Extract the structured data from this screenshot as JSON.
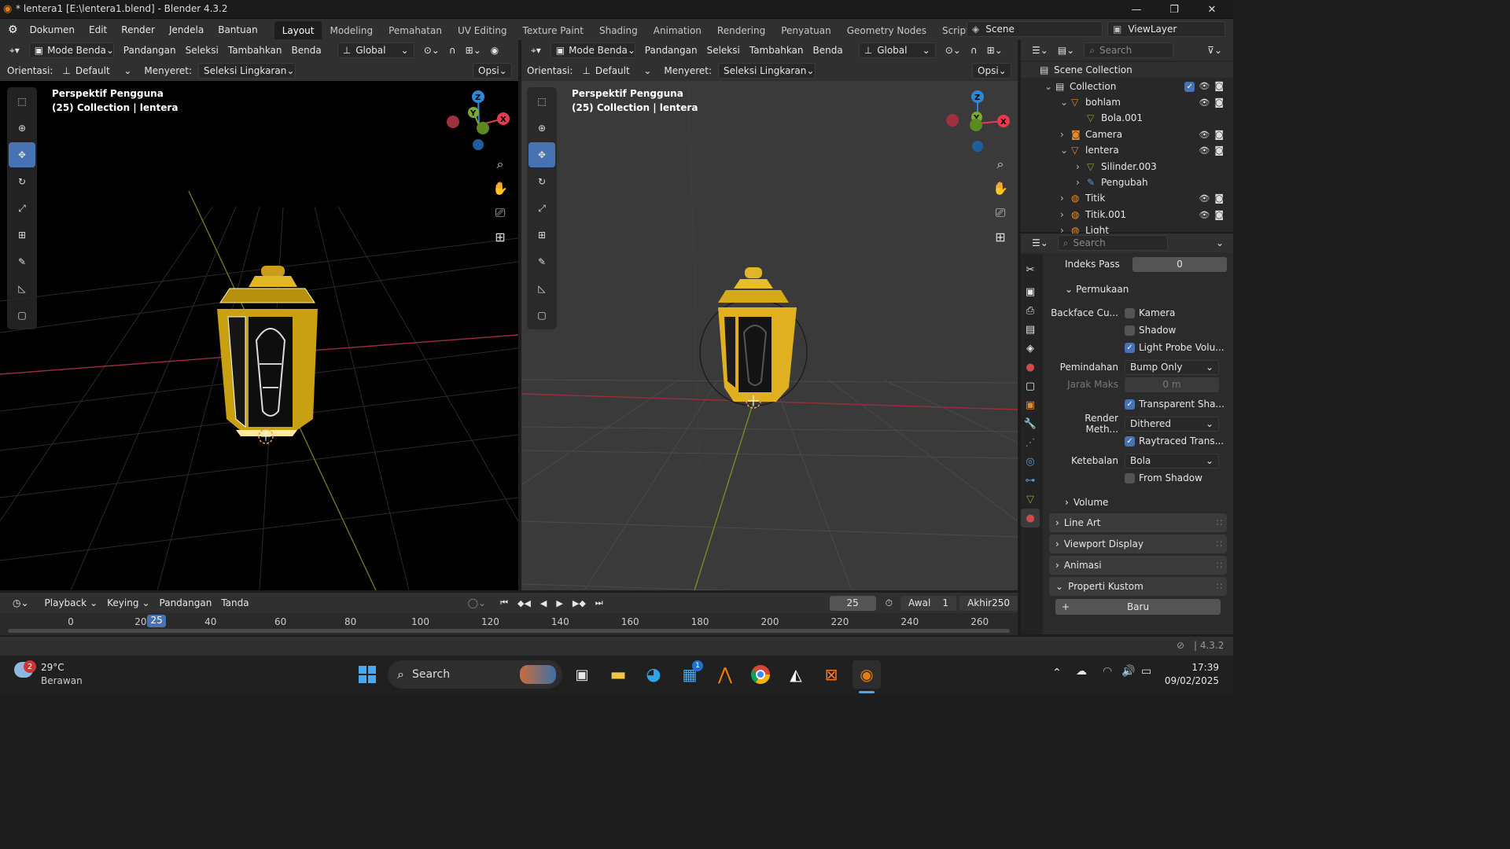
{
  "window": {
    "title": "* lentera1 [E:\\lentera1.blend] - Blender 4.3.2",
    "minimize": "—",
    "maximize": "❐",
    "close": "✕"
  },
  "menu": {
    "logo": "⚙",
    "items": [
      "Dokumen",
      "Edit",
      "Render",
      "Jendela",
      "Bantuan"
    ]
  },
  "workspaces": [
    "Layout",
    "Modeling",
    "Pemahatan",
    "UV Editing",
    "Texture Paint",
    "Shading",
    "Animation",
    "Rendering",
    "Penyatuan",
    "Geometry Nodes",
    "Scripting"
  ],
  "workspace_add": "+",
  "scene": {
    "label": "Scene",
    "viewlayer": "ViewLayer"
  },
  "vp_left": {
    "mode": "Mode Benda",
    "menus": [
      "Pandangan",
      "Seleksi",
      "Tambahkan",
      "Benda"
    ],
    "transform": "Global",
    "orient_label": "Orientasi:",
    "orient_value": "Default",
    "drag_label": "Menyeret:",
    "drag_value": "Seleksi Lingkaran",
    "options": "Opsi",
    "overlay_line1": "Perspektif Pengguna",
    "overlay_line2": "(25) Collection | lentera"
  },
  "vp_right": {
    "mode": "Mode Benda",
    "menus": [
      "Pandangan",
      "Seleksi",
      "Tambahkan",
      "Benda"
    ],
    "transform": "Global",
    "orient_label": "Orientasi:",
    "orient_value": "Default",
    "drag_label": "Menyeret:",
    "drag_value": "Seleksi Lingkaran",
    "options": "Opsi",
    "overlay_line1": "Perspektif Pengguna",
    "overlay_line2": "(25) Collection | lentera"
  },
  "gizmo": {
    "x": "X",
    "y": "Y",
    "z": "Z",
    "colors": {
      "x": "#e8394f",
      "y": "#7aab2b",
      "z": "#2d87d9"
    }
  },
  "outliner": {
    "search_placeholder": "Search",
    "rows": [
      {
        "label": "Scene Collection",
        "indent": 0,
        "icon": "collection-icon"
      },
      {
        "label": "Collection",
        "indent": 1,
        "icon": "collection-icon"
      },
      {
        "label": "bohlam",
        "indent": 2,
        "icon": "mesh-object-icon"
      },
      {
        "label": "Bola.001",
        "indent": 3,
        "icon": "mesh-data-icon"
      },
      {
        "label": "Camera",
        "indent": 2,
        "icon": "camera-icon"
      },
      {
        "label": "lentera",
        "indent": 2,
        "icon": "mesh-object-icon"
      },
      {
        "label": "Silinder.003",
        "indent": 3,
        "icon": "mesh-data-icon"
      },
      {
        "label": "Pengubah",
        "indent": 3,
        "icon": "modifier-icon"
      },
      {
        "label": "Titik",
        "indent": 2,
        "icon": "light-icon"
      },
      {
        "label": "Titik.001",
        "indent": 2,
        "icon": "light-icon"
      },
      {
        "label": "Light",
        "indent": 2,
        "icon": "light-icon"
      }
    ]
  },
  "properties": {
    "search_placeholder": "Search",
    "pass_index_label": "Indeks Pass",
    "pass_index_value": "0",
    "surface_header": "Permukaan",
    "backface_label": "Backface Cu...",
    "cb_camera": "Kamera",
    "cb_shadow": "Shadow",
    "cb_lightprobe": "Light Probe Volu...",
    "displacement_label": "Pemindahan",
    "displacement_value": "Bump Only",
    "max_dist_label": "Jarak Maks",
    "max_dist_value": "0 m",
    "cb_transparent": "Transparent Sha...",
    "render_method_label": "Render Meth...",
    "render_method_value": "Dithered",
    "cb_raytraced": "Raytraced Trans...",
    "thickness_label": "Ketebalan",
    "thickness_value": "Bola",
    "cb_from_shadow": "From Shadow",
    "volume": "Volume",
    "line_art": "Line Art",
    "viewport_display": "Viewport Display",
    "animasi": "Animasi",
    "custom_props": "Properti Kustom",
    "new_button": "Baru"
  },
  "timeline": {
    "playback": "Playback",
    "keying": "Keying",
    "view": "Pandangan",
    "marker": "Tanda",
    "current_frame": "25",
    "start_label": "Awal",
    "start_value": "1",
    "end_label": "Akhir",
    "end_value": "250",
    "ticks": [
      "0",
      "20",
      "40",
      "60",
      "80",
      "100",
      "120",
      "140",
      "160",
      "180",
      "200",
      "220",
      "240",
      "260"
    ],
    "playhead": "25"
  },
  "statusbar": {
    "version": "4.3.2"
  },
  "taskbar": {
    "weather_temp": "29°C",
    "weather_desc": "Berawan",
    "weather_badge": "2",
    "search": "Search",
    "store_badge": "1",
    "time": "17:39",
    "date": "09/02/2025"
  }
}
